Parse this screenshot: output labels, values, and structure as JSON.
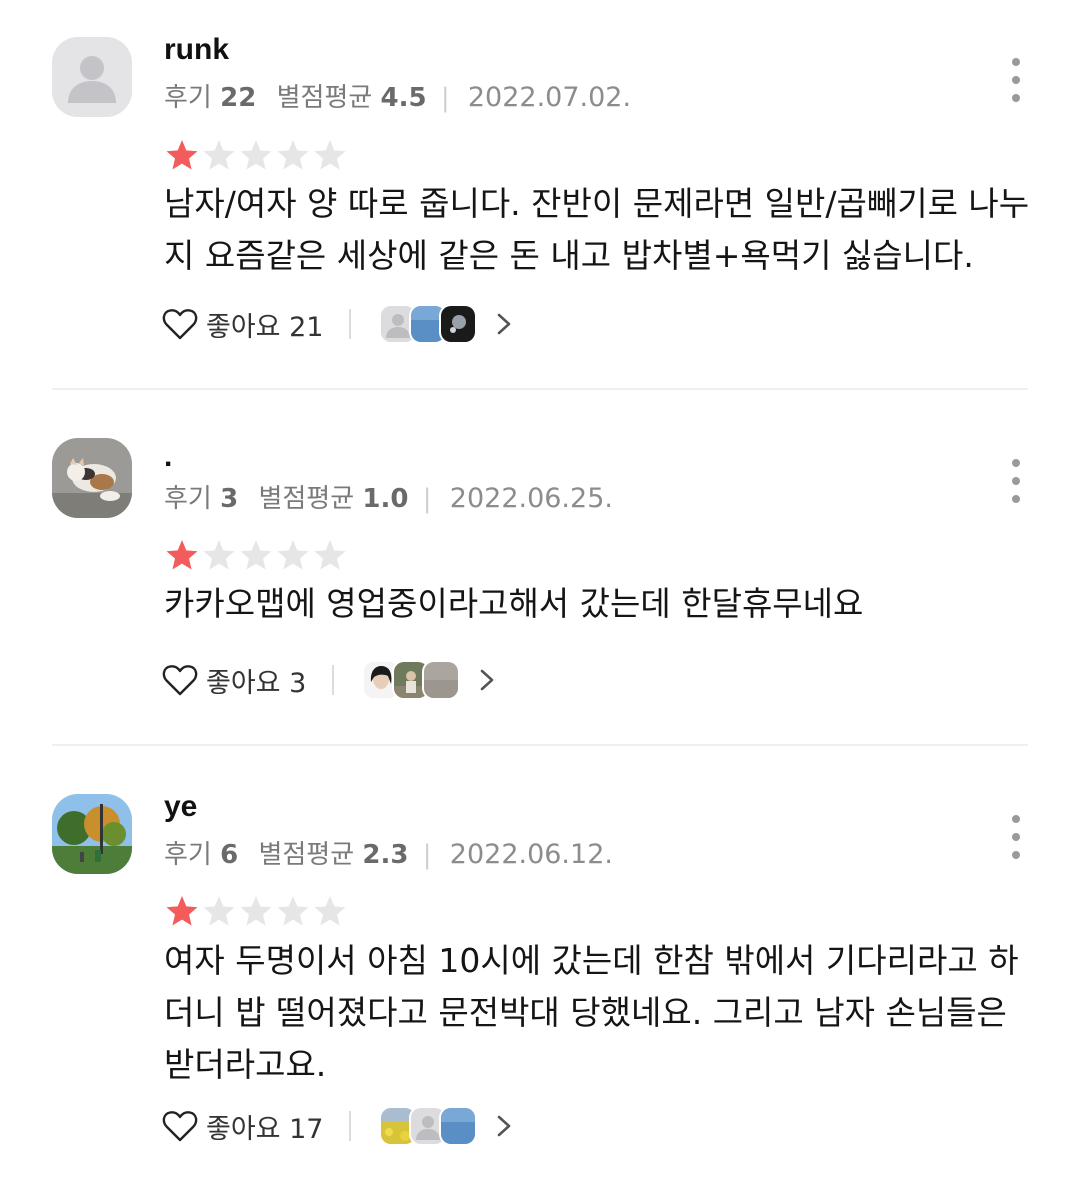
{
  "reviews": [
    {
      "username": "runk",
      "review_count_label": "후기",
      "review_count": "22",
      "avg_label": "별점평균",
      "avg": "4.5",
      "date": "2022.07.02.",
      "rating": 1,
      "rating_max": 5,
      "text": "남자/여자 양 따로 줍니다. 잔반이 문제라면 일반/곱빼기로 나누지 요즘같은 세상에 같은 돈 내고 밥차별+욕먹기 싫습니다.",
      "like_label": "좋아요",
      "like_count": "21"
    },
    {
      "username": ".",
      "review_count_label": "후기",
      "review_count": "3",
      "avg_label": "별점평균",
      "avg": "1.0",
      "date": "2022.06.25.",
      "rating": 1,
      "rating_max": 5,
      "text": "카카오맵에 영업중이라고해서 갔는데 한달휴무네요",
      "like_label": "좋아요",
      "like_count": "3"
    },
    {
      "username": "ye",
      "review_count_label": "후기",
      "review_count": "6",
      "avg_label": "별점평균",
      "avg": "2.3",
      "date": "2022.06.12.",
      "rating": 1,
      "rating_max": 5,
      "text": "여자 두명이서 아침 10시에 갔는데 한참 밖에서 기다리라고 하더니 밥 떨어졌다고 문전박대 당했네요. 그리고 남자 손님들은 받더라고요.",
      "like_label": "좋아요",
      "like_count": "17"
    }
  ],
  "colors": {
    "star_filled": "#f25c5c",
    "star_empty": "#e6e6e6",
    "meta_text": "#7a7a7a",
    "divider": "#efefef"
  },
  "icons": {
    "more": "more-vertical-icon",
    "heart": "heart-outline-icon",
    "chevron": "chevron-right-icon",
    "star": "star-icon"
  }
}
